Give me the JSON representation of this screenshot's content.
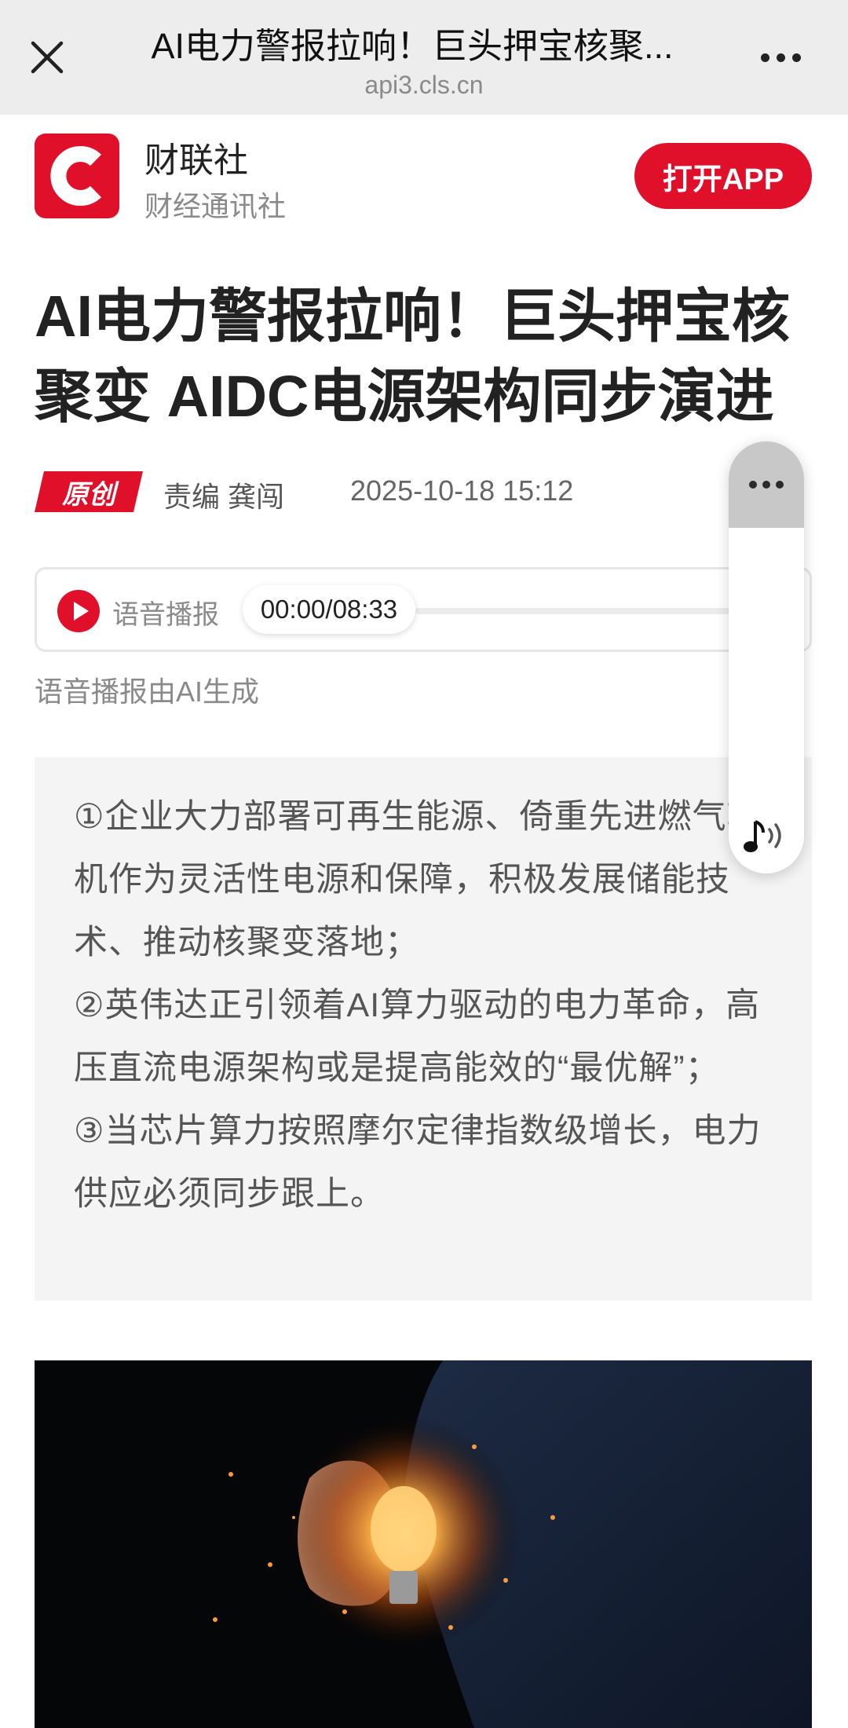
{
  "browser": {
    "title": "AI电力警报拉响！巨头押宝核聚...",
    "url": "api3.cls.cn"
  },
  "app_banner": {
    "logo_letter": "C",
    "name": "财联社",
    "subtitle": "财经通讯社",
    "open_button": "打开APP"
  },
  "article": {
    "headline_bold_1": "AI",
    "headline_1": "电力警报拉响！巨头押宝核聚变 ",
    "headline_bold_2": "AIDC",
    "headline_2": "电源架构同步演进",
    "badge": "原创",
    "editor": "责编 龚闯",
    "date": "2025-10-18 15:12"
  },
  "player": {
    "label": "语音播报",
    "time": "00:00/08:33",
    "progress": 0,
    "note": "语音播报由AI生成"
  },
  "summary": {
    "items": [
      "①企业大力部署可再生能源、倚重先进燃气轮机作为灵活性电源和保障，积极发展储能技术、推动核聚变落地；",
      "②英伟达正引领着AI算力驱动的电力革命，高压直流电源架构或是提高能效的“最优解”；",
      "③当芯片算力按照摩尔定律指数级增长，电力供应必须同步跟上。"
    ]
  },
  "colors": {
    "brand_red": "#e0102a",
    "topbar_bg": "#ededed",
    "summary_bg": "#f4f4f4"
  },
  "icons": {
    "close": "close-icon",
    "more": "more-icon",
    "play": "play-icon",
    "float_more": "more-icon",
    "speaker": "music-speaker-icon"
  }
}
